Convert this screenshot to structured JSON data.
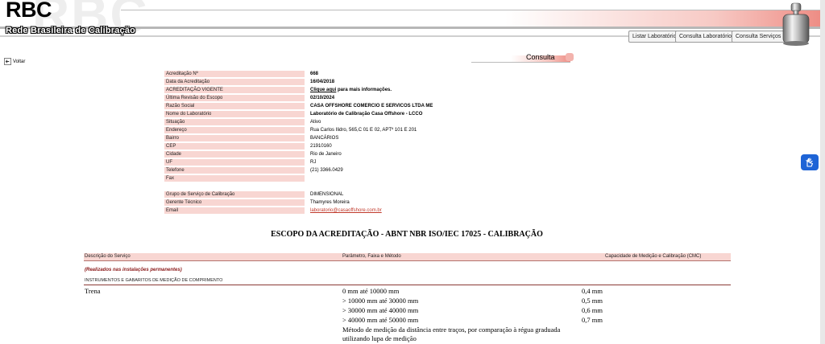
{
  "header": {
    "logo": "RBC",
    "subtitle": "Rede Brasileira de Calibração",
    "nav": [
      {
        "label": "Listar Laboratórios"
      },
      {
        "label": "Consulta Laboratórios"
      },
      {
        "label": "Consulta Serviços"
      }
    ]
  },
  "voltar_label": "Voltar",
  "consulta_label": "Consulta",
  "info": [
    {
      "label": "Acreditação Nº",
      "value": "668",
      "bold": true
    },
    {
      "label": "Data da Acreditação",
      "value": "16/04/2018",
      "bold": true
    },
    {
      "label": "ACREDITAÇÃO VIGENTE",
      "link": "Clique aqui",
      "value": " para mais informações.",
      "bold": true
    },
    {
      "label": "Última Revisão do Escopo",
      "value": "02/10/2024",
      "bold": true
    },
    {
      "label": "Razão Social",
      "value": "CASA OFFSHORE COMERCIO E SERVICOS LTDA ME",
      "bold": true
    },
    {
      "label": "Nome do Laboratório",
      "value": "Laboratório de Calibração Casa Offshore - LCCO",
      "bold": true
    },
    {
      "label": "Situação",
      "value": "Ativo",
      "bold": false
    },
    {
      "label": "Endereço",
      "value": "Rua Carlos Ilidro, 565,C 01 E 02, APTº 101 E 201",
      "bold": false
    },
    {
      "label": "Bairro",
      "value": "BANCÁRIOS",
      "bold": false
    },
    {
      "label": "CEP",
      "value": "21910160",
      "bold": false
    },
    {
      "label": "Cidade",
      "value": "Rio de Janeiro",
      "bold": false
    },
    {
      "label": "UF",
      "value": "RJ",
      "bold": false
    },
    {
      "label": "Telefone",
      "value": "(21) 3366.0429",
      "bold": false
    },
    {
      "label": "Fax",
      "value": "",
      "bold": false
    }
  ],
  "info2": [
    {
      "label": "Grupo de Serviço de Calibração",
      "value": "DIMENSIONAL"
    },
    {
      "label": "Gerente Técnico",
      "value": "Thamyres Moreira"
    },
    {
      "label": "Email",
      "value": "laboratorio@casaoffshore.com.br",
      "email": true
    }
  ],
  "scope_title": "ESCOPO DA ACREDITAÇÃO - ABNT NBR ISO/IEC 17025 - CALIBRAÇÃO",
  "table": {
    "headers": [
      "Descrição do Serviço",
      "Parâmetro, Faixa e Método",
      "Capacidade de Medição e Calibração (CMC)"
    ],
    "note": "(Realizados nas instalações permanentes)",
    "category": "INSTRUMENTOS E GABARITOS DE MEDIÇÃO DE COMPRIMENTO",
    "item": "Trena",
    "rows": [
      {
        "param": "0 mm até 10000 mm",
        "cmc": "0,4 mm"
      },
      {
        "param": "> 10000 mm até 30000 mm",
        "cmc": "0,5 mm"
      },
      {
        "param": "> 30000 mm até 40000 mm",
        "cmc": "0,6 mm"
      },
      {
        "param": "> 40000 mm até 50000 mm",
        "cmc": "0,7 mm"
      }
    ],
    "method": "Método de medição da distância entre traços, por comparação à régua graduada utilizando lupa de medição"
  }
}
